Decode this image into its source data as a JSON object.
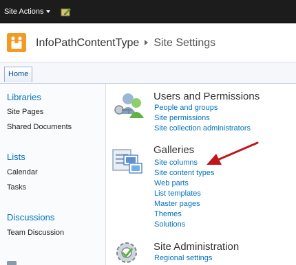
{
  "topbar": {
    "site_actions": "Site Actions"
  },
  "header": {
    "site_title": "InfoPathContentType",
    "current_page": "Site Settings"
  },
  "topnav": {
    "tabs": [
      "Home"
    ]
  },
  "quicklaunch": {
    "libraries": {
      "heading": "Libraries",
      "items": [
        "Site Pages",
        "Shared Documents"
      ]
    },
    "lists": {
      "heading": "Lists",
      "items": [
        "Calendar",
        "Tasks"
      ]
    },
    "discussions": {
      "heading": "Discussions",
      "items": [
        "Team Discussion"
      ]
    }
  },
  "sections": {
    "users_permissions": {
      "title": "Users and Permissions",
      "links": [
        "People and groups",
        "Site permissions",
        "Site collection administrators"
      ]
    },
    "galleries": {
      "title": "Galleries",
      "links": [
        "Site columns",
        "Site content types",
        "Web parts",
        "List templates",
        "Master pages",
        "Themes",
        "Solutions"
      ]
    },
    "site_administration": {
      "title": "Site Administration",
      "links": [
        "Regional settings"
      ]
    }
  },
  "colors": {
    "topbar": "#1c1c1c",
    "link": "#0072bc",
    "annotation_arrow": "#c0171c",
    "logo": "#f29a22"
  }
}
